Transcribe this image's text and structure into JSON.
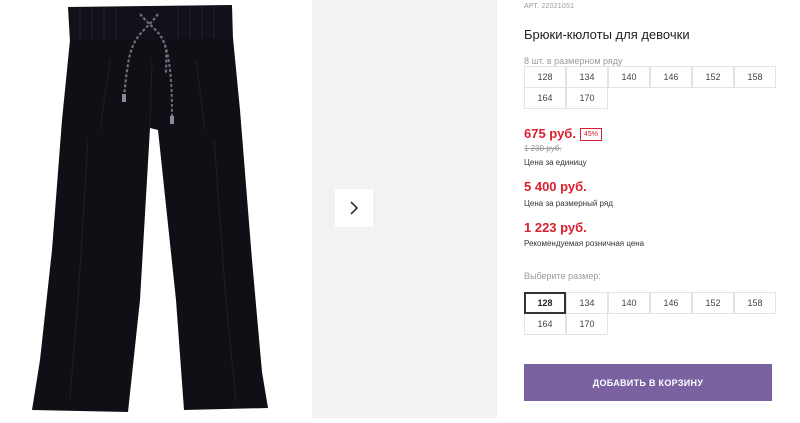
{
  "product": {
    "sku": "АРТ. 22021051",
    "title": "Брюки-кюлоты для девочки"
  },
  "size_row": {
    "hint": "8 шт. в размерном ряду",
    "sizes": [
      "128",
      "134",
      "140",
      "146",
      "152",
      "158",
      "164",
      "170"
    ]
  },
  "pricing": {
    "unit_price": "675 руб.",
    "discount_badge": "45%",
    "old_price": "1 230 руб.",
    "unit_caption": "Цена за единицу",
    "row_price": "5 400 руб.",
    "row_caption": "Цена за размерный ряд",
    "retail_price": "1 223 руб.",
    "retail_caption": "Рекомендуемая розничная цена"
  },
  "size_select": {
    "label": "Выберите размер:",
    "selected": "128",
    "sizes": [
      "128",
      "134",
      "140",
      "146",
      "152",
      "158",
      "164",
      "170"
    ]
  },
  "cart": {
    "add_label": "ДОБАВИТЬ В КОРЗИНУ"
  },
  "colors": {
    "accent": "#7a62a2",
    "price": "#d8202f",
    "product": "#0f0f16"
  },
  "icons": {
    "next": "chevron-right-icon"
  }
}
